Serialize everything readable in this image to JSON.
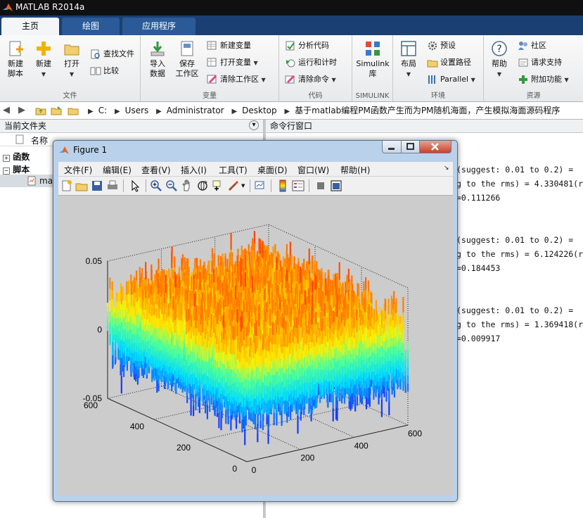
{
  "app": {
    "title": "MATLAB R2014a"
  },
  "tabs": [
    {
      "label": "主页"
    },
    {
      "label": "绘图"
    },
    {
      "label": "应用程序"
    }
  ],
  "ribbon": {
    "file_group": {
      "label": "文件",
      "new_script": "新建\n脚本",
      "new": "新建",
      "open": "打开",
      "find_files": "查找文件",
      "compare": "比较"
    },
    "var_group": {
      "label": "变量",
      "import": "导入\n数据",
      "save_ws": "保存\n工作区",
      "new_var": "新建变量",
      "open_var": "打开变量",
      "clear_ws": "清除工作区"
    },
    "code_group": {
      "label": "代码",
      "analyze": "分析代码",
      "run_time": "运行和计时",
      "clear_cmd": "清除命令"
    },
    "simulink_group": {
      "label": "SIMULINK",
      "simulink": "Simulink\n库"
    },
    "env_group": {
      "label": "环境",
      "layout": "布局",
      "prefs": "预设",
      "set_path": "设置路径",
      "parallel": "Parallel"
    },
    "res_group": {
      "label": "资源",
      "help": "帮助",
      "community": "社区",
      "support": "请求支持",
      "addons": "附加功能"
    }
  },
  "path": {
    "crumbs": [
      "C:",
      "Users",
      "Administrator",
      "Desktop",
      "基于matlab编程PM函数产生而为PM随机海面，产生模拟海面源码程序"
    ]
  },
  "current_folder": {
    "title": "当前文件夹",
    "column": "名称",
    "groups": [
      {
        "label": "函数",
        "sign": "+"
      },
      {
        "label": "脚本",
        "sign": "−"
      }
    ],
    "file": "ma"
  },
  "command_window": {
    "title": "命令行窗口",
    "lines": [
      " (suggest: 0.01 to 0.2) =",
      "g to the rms) = 4.330481(r",
      "=0.111266",
      " (suggest: 0.01 to 0.2) =",
      "g to the rms) = 6.124226(r",
      "=0.184453",
      " (suggest: 0.01 to 0.2) =",
      "g to the rms) = 1.369418(r",
      "=0.009917"
    ]
  },
  "figure": {
    "title": "Figure 1",
    "menu": [
      "文件(F)",
      "编辑(E)",
      "查看(V)",
      "插入(I)",
      "工具(T)",
      "桌面(D)",
      "窗口(W)",
      "帮助(H)"
    ],
    "z_ticks": [
      "0.05",
      "0",
      "-0.05"
    ],
    "y_ticks": [
      "600",
      "400",
      "200",
      "0"
    ],
    "x_ticks": [
      "0",
      "200",
      "400",
      "600"
    ]
  },
  "colors": {
    "ribbon_tab_bar": "#1a3f72",
    "surface_high": "#ff3b00",
    "surface_low": "#1a5aff"
  }
}
